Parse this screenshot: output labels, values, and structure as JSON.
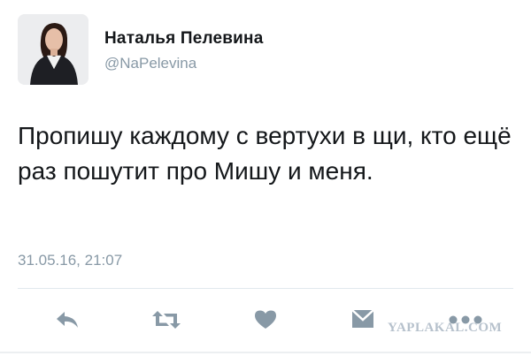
{
  "tweet": {
    "author_name": "Наталья Пелевина",
    "author_handle": "@NaPelevina",
    "text": "Пропишу каждому с вертухи в щи, кто ещё раз пошутит про Мишу и меня.",
    "timestamp": "31.05.16, 21:07"
  },
  "actions": {
    "icons": [
      "reply-icon",
      "retweet-icon",
      "like-icon",
      "message-icon",
      "more-icon"
    ],
    "icon_color": "#8899a6"
  },
  "watermark": {
    "text": "YAPLAKAL.COM"
  },
  "colors": {
    "text": "#14171a",
    "secondary": "#8899a6",
    "divider": "#e1e8ed"
  }
}
